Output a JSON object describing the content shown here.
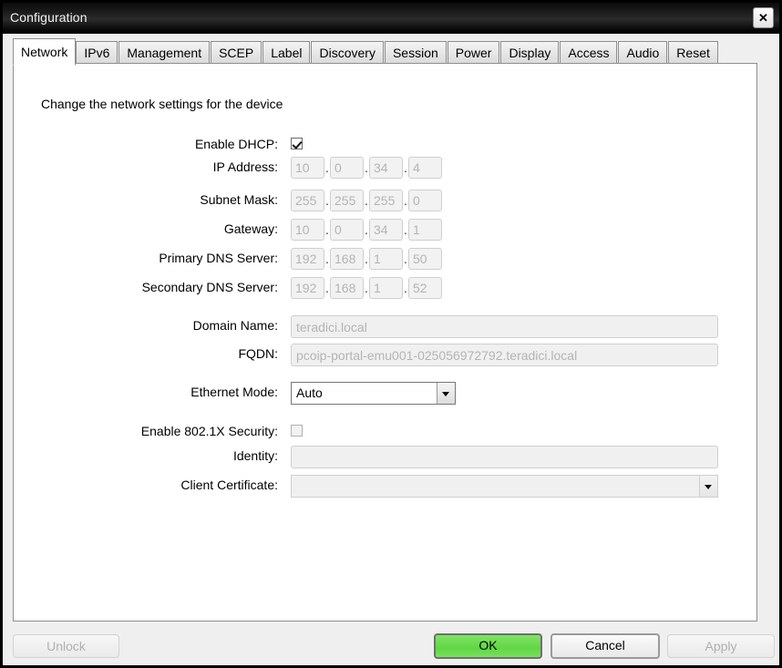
{
  "window": {
    "title": "Configuration",
    "close_label": "✕"
  },
  "tabs": [
    {
      "label": "Network",
      "active": true
    },
    {
      "label": "IPv6",
      "active": false
    },
    {
      "label": "Management",
      "active": false
    },
    {
      "label": "SCEP",
      "active": false
    },
    {
      "label": "Label",
      "active": false
    },
    {
      "label": "Discovery",
      "active": false
    },
    {
      "label": "Session",
      "active": false
    },
    {
      "label": "Power",
      "active": false
    },
    {
      "label": "Display",
      "active": false
    },
    {
      "label": "Access",
      "active": false
    },
    {
      "label": "Audio",
      "active": false
    },
    {
      "label": "Reset",
      "active": false
    }
  ],
  "panel": {
    "headline": "Change the network settings for the device",
    "enable_dhcp": {
      "label": "Enable DHCP:",
      "checked": true
    },
    "ip_address": {
      "label": "IP Address:",
      "octets": [
        "10",
        "0",
        "34",
        "4"
      ]
    },
    "subnet_mask": {
      "label": "Subnet Mask:",
      "octets": [
        "255",
        "255",
        "255",
        "0"
      ]
    },
    "gateway": {
      "label": "Gateway:",
      "octets": [
        "10",
        "0",
        "34",
        "1"
      ]
    },
    "primary_dns": {
      "label": "Primary DNS Server:",
      "octets": [
        "192",
        "168",
        "1",
        "50"
      ]
    },
    "secondary_dns": {
      "label": "Secondary DNS Server:",
      "octets": [
        "192",
        "168",
        "1",
        "52"
      ]
    },
    "domain_name": {
      "label": "Domain Name:",
      "value": "teradici.local"
    },
    "fqdn": {
      "label": "FQDN:",
      "value": "pcoip-portal-emu001-025056972792.teradici.local"
    },
    "ethernet_mode": {
      "label": "Ethernet Mode:",
      "value": "Auto"
    },
    "enable_8021x": {
      "label": "Enable 802.1X Security:",
      "checked": false
    },
    "identity": {
      "label": "Identity:",
      "value": ""
    },
    "client_certificate": {
      "label": "Client Certificate:",
      "value": ""
    },
    "separator": "."
  },
  "footer": {
    "unlock": "Unlock",
    "ok": "OK",
    "cancel": "Cancel",
    "apply": "Apply"
  },
  "colors": {
    "ok_green": "#6ada4e",
    "titlebar": "#111111",
    "panel_bg": "#ffffff",
    "dialog_bg": "#efefef",
    "disabled_text": "#b4b4b4"
  }
}
